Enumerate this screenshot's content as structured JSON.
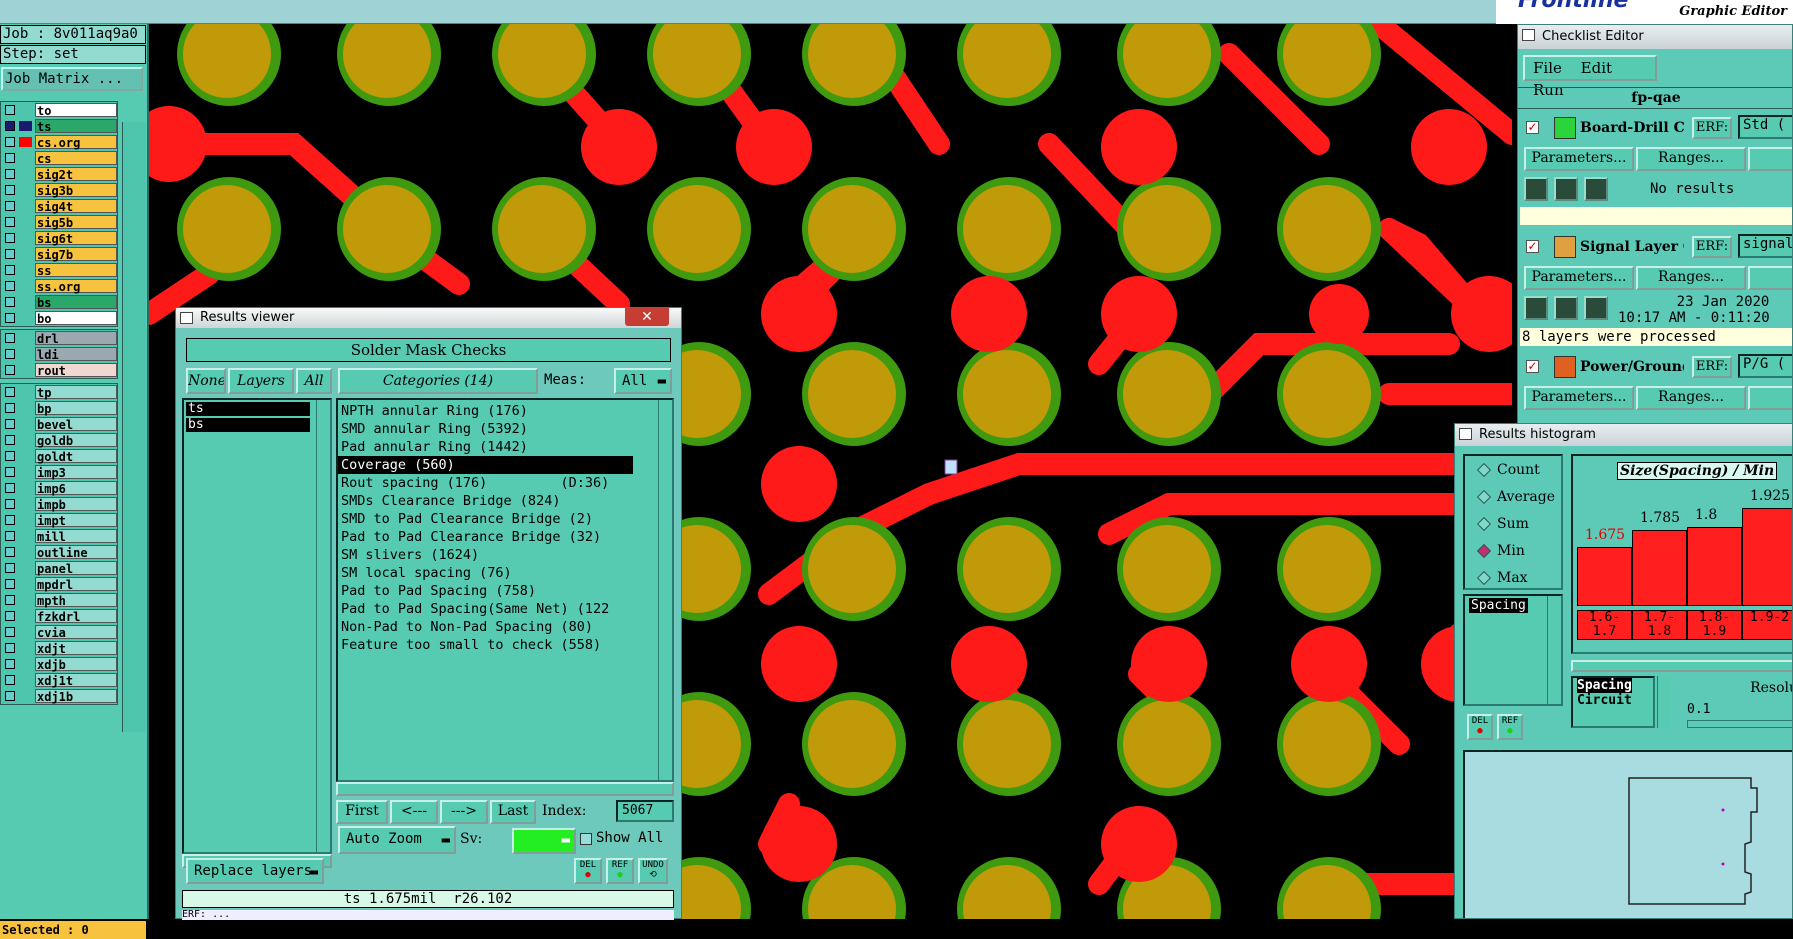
{
  "left_panel": {
    "job_label": "Job : 8v011aq9a0",
    "step_label": "Step: set",
    "job_matrix_button": "Job Matrix ...",
    "layers_group1": [
      {
        "name": "to",
        "swatch": "",
        "bg": "#ffffff",
        "active": false
      },
      {
        "name": "ts",
        "swatch": "#1a1a6e",
        "bg": "#2aa86a",
        "active": true
      },
      {
        "name": "cs.org",
        "swatch": "#ff0000",
        "bg": "#f7c23e",
        "active": false
      },
      {
        "name": "cs",
        "swatch": "",
        "bg": "#f7c23e",
        "active": false
      },
      {
        "name": "sig2t",
        "swatch": "",
        "bg": "#f7c23e",
        "active": false
      },
      {
        "name": "sig3b",
        "swatch": "",
        "bg": "#f7c23e",
        "active": false
      },
      {
        "name": "sig4t",
        "swatch": "",
        "bg": "#f7c23e",
        "active": false
      },
      {
        "name": "sig5b",
        "swatch": "",
        "bg": "#f7c23e",
        "active": false
      },
      {
        "name": "sig6t",
        "swatch": "",
        "bg": "#f7c23e",
        "active": false
      },
      {
        "name": "sig7b",
        "swatch": "",
        "bg": "#f7c23e",
        "active": false
      },
      {
        "name": "ss",
        "swatch": "",
        "bg": "#f7c23e",
        "active": false
      },
      {
        "name": "ss.org",
        "swatch": "",
        "bg": "#f7c23e",
        "active": false
      },
      {
        "name": "bs",
        "swatch": "",
        "bg": "#2aa86a",
        "active": false
      },
      {
        "name": "bo",
        "swatch": "",
        "bg": "#ffffff",
        "active": false
      }
    ],
    "layers_group2": [
      {
        "name": "drl",
        "swatch": "",
        "bg": "#9aa8b0",
        "active": false
      },
      {
        "name": "ldi",
        "swatch": "",
        "bg": "#9aa8b0",
        "active": false
      },
      {
        "name": "rout",
        "swatch": "",
        "bg": "#f0d7d0",
        "active": false
      }
    ],
    "layers_group3": [
      {
        "name": "tp"
      },
      {
        "name": "bp"
      },
      {
        "name": "bevel"
      },
      {
        "name": "goldb"
      },
      {
        "name": "goldt"
      },
      {
        "name": "imp3"
      },
      {
        "name": "imp6"
      },
      {
        "name": "impb"
      },
      {
        "name": "impt"
      },
      {
        "name": "mill"
      },
      {
        "name": "outline"
      },
      {
        "name": "panel"
      },
      {
        "name": "mpdrl"
      },
      {
        "name": "mpth"
      },
      {
        "name": "fzkdrl"
      },
      {
        "name": "cvia"
      },
      {
        "name": "xdjt"
      },
      {
        "name": "xdjb"
      },
      {
        "name": "xdj1t"
      },
      {
        "name": "xdj1b"
      }
    ],
    "selected_label": "Selected : 0"
  },
  "results_viewer": {
    "window_title": "Results viewer",
    "close_glyph": "✕",
    "panel_title": "Solder Mask Checks",
    "none_button": "None",
    "layers_button": "Layers",
    "all_button": "All",
    "layers": [
      "ts",
      "bs"
    ],
    "categories_button": "Categories (14)",
    "meas_label": "Meas:",
    "meas_value": "All",
    "categories": [
      {
        "text": "NPTH annular Ring (176)",
        "selected": false
      },
      {
        "text": "SMD annular Ring (5392)",
        "selected": false
      },
      {
        "text": "Pad annular Ring (1442)",
        "selected": false
      },
      {
        "text": "Coverage (560)",
        "selected": true
      },
      {
        "text": "Rout spacing (176)         (D:36)",
        "selected": false
      },
      {
        "text": "SMDs Clearance Bridge (824)",
        "selected": false
      },
      {
        "text": "SMD to Pad Clearance Bridge (2)",
        "selected": false
      },
      {
        "text": "Pad to Pad Clearance Bridge (32)",
        "selected": false
      },
      {
        "text": "SM slivers (1624)",
        "selected": false
      },
      {
        "text": "SM local spacing (76)",
        "selected": false
      },
      {
        "text": "Pad to Pad Spacing (758)",
        "selected": false
      },
      {
        "text": "Pad to Pad Spacing(Same Net) (122",
        "selected": false
      },
      {
        "text": "Non-Pad to Non-Pad Spacing (80)",
        "selected": false
      },
      {
        "text": "Feature too small to check (558)",
        "selected": false
      }
    ],
    "first_button": "First",
    "prev_button": "<---",
    "next_button": "--->",
    "last_button": "Last",
    "index_label": "Index:",
    "index_value": "5067",
    "zoom_button": "Auto Zoom",
    "sv_label": "Sv:",
    "show_all_label": "Show All",
    "replace_layers_button": "Replace layers",
    "del_label": "DEL",
    "ref_label": "REF",
    "undo_label": "UNDO",
    "status_text": "ts 1.675mil  r26.102",
    "bottom_text": "ERF: ..."
  },
  "checklist_editor": {
    "window_title": "Checklist Editor",
    "menu": [
      "File",
      "Edit",
      "Run"
    ],
    "checklist_name": "fp-qae",
    "checks": [
      {
        "name": "Board-Drill Che",
        "erf": "ERF:",
        "erf_value": "Std (",
        "params": "Parameters...",
        "ranges": "Ranges...",
        "status1": "No results",
        "status2": "",
        "icon_color": "#2bd43a"
      },
      {
        "name": "Signal Layer Ch",
        "erf": "ERF:",
        "erf_value": "signal",
        "params": "Parameters...",
        "ranges": "Ranges...",
        "status1": "23 Jan 2020",
        "status2": "10:17 AM - 0:11:20",
        "note": "8 layers were processed",
        "icon_color": "#e0a040"
      },
      {
        "name": "Power/Ground C",
        "erf": "ERF:",
        "erf_value": "P/G (",
        "params": "Parameters...",
        "ranges": "Ranges...",
        "icon_color": "#e06020"
      }
    ]
  },
  "histogram": {
    "window_title": "Results histogram",
    "options": [
      {
        "label": "Count",
        "on": false
      },
      {
        "label": "Average",
        "on": false
      },
      {
        "label": "Sum",
        "on": false
      },
      {
        "label": "Min",
        "on": true
      },
      {
        "label": "Max",
        "on": false
      }
    ],
    "measure_list": [
      "Spacing"
    ],
    "chart_title": "Size(Spacing) / Min",
    "bars": [
      {
        "value": 1.675,
        "label": "1.675",
        "bin": "1.6-1.7"
      },
      {
        "value": 1.785,
        "label": "1.785",
        "bin": "1.7-1.8"
      },
      {
        "value": 1.8,
        "label": "1.8",
        "bin": "1.8-1.9"
      },
      {
        "value": 1.925,
        "label": "1.925",
        "bin": "1.9-2"
      }
    ],
    "type_list": [
      "Spacing",
      "Circuit"
    ],
    "resolution_label": "Resolu",
    "resolution_value": "0.1",
    "del_label": "DEL",
    "ref_label": "REF"
  },
  "header": {
    "logo_text": "Frontline",
    "subtitle": "Graphic Editor"
  },
  "colors": {
    "pad_outer": "#3f9a10",
    "pad_inner": "#c09a08",
    "trace": "#ff1a1a",
    "board_bg": "#000000"
  }
}
